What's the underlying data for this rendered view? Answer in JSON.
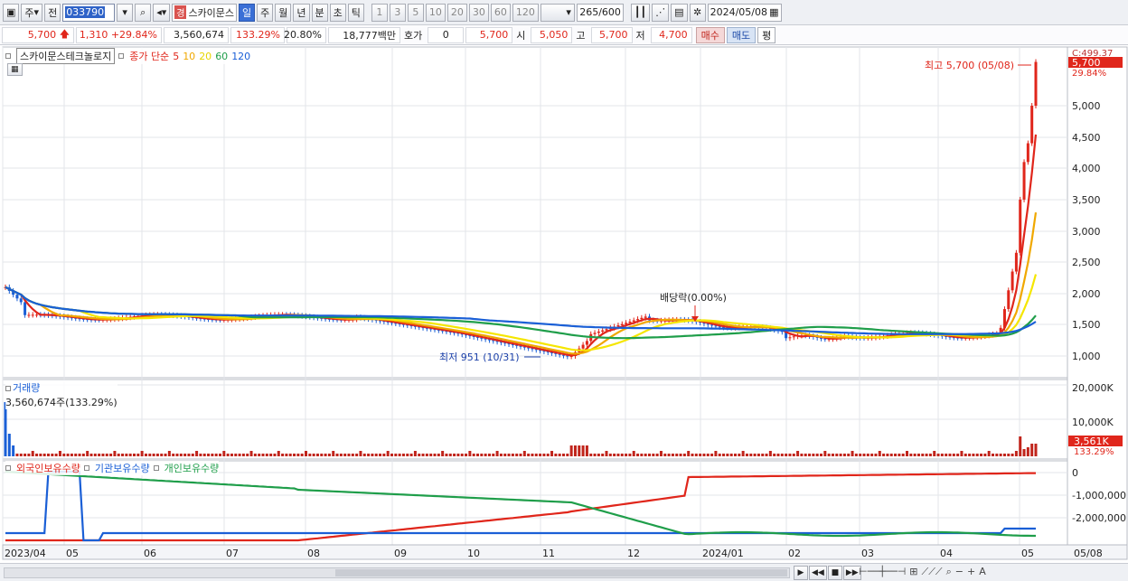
{
  "toolbar": {
    "market_label": "주",
    "prev_label": "전",
    "code": "033790",
    "name": "스카이문스",
    "name_badge": "경",
    "periods": [
      "일",
      "주",
      "월",
      "년",
      "분",
      "초",
      "틱"
    ],
    "active_period": "일",
    "intervals": [
      "1",
      "3",
      "5",
      "10",
      "20",
      "30",
      "60",
      "120"
    ],
    "count": "265",
    "count_total": "/600",
    "date": "2024/05/08"
  },
  "quote": {
    "price": "5,700",
    "change": "1,310",
    "change_pct": "+29.84%",
    "volume": "3,560,674",
    "vol_ratio": "133.29%",
    "turnover": "20.80%",
    "amount": "18,777백만",
    "hoga_label": "호가",
    "hoga_value": "0",
    "hoga_price": "5,700",
    "open_label": "시",
    "open": "5,050",
    "high_label": "고",
    "high": "5,700",
    "low_label": "저",
    "low": "4,700",
    "buy_label": "매수",
    "sell_label": "매도",
    "avg_label": "평"
  },
  "price_legend": {
    "name": "스카이문스테크놀로지",
    "ma_label": "종가 단순",
    "mas": [
      {
        "period": "5",
        "color": "#e0261b"
      },
      {
        "period": "10",
        "color": "#f0a800"
      },
      {
        "period": "20",
        "color": "#f5e600"
      },
      {
        "period": "60",
        "color": "#1f9e4a"
      },
      {
        "period": "120",
        "color": "#1a5fd6"
      }
    ]
  },
  "price_axis": {
    "ticks": [
      "5,000",
      "4,500",
      "4,000",
      "3,500",
      "3,000",
      "2,500",
      "2,000",
      "1,500",
      "1,000"
    ],
    "last_price": "5,700",
    "pct": "29.84%",
    "top_label": "C:499.37"
  },
  "annotations": {
    "high": "최고 5,700 (05/08)",
    "low": "최저 951 (10/31)",
    "dividend": "배당락(0.00%)"
  },
  "volume_panel": {
    "title": "거래량",
    "value": "3,560,674주(133.29%)",
    "ticks": [
      "20,000K",
      "10,000K"
    ],
    "last": "3,561K",
    "last_pct": "133.29%"
  },
  "holdings_panel": {
    "series": [
      {
        "name": "외국인보유수량",
        "color": "#e0261b"
      },
      {
        "name": "기관보유수량",
        "color": "#1a5fd6"
      },
      {
        "name": "개인보유수량",
        "color": "#1f9e4a"
      }
    ],
    "ticks": [
      "0",
      "-1,000,000",
      "-2,000,000"
    ]
  },
  "x_axis": {
    "labels": [
      "2023/04",
      "05",
      "06",
      "07",
      "08",
      "09",
      "10",
      "11",
      "12",
      "2024/01",
      "02",
      "03",
      "04",
      "05",
      "05/08"
    ]
  }
}
